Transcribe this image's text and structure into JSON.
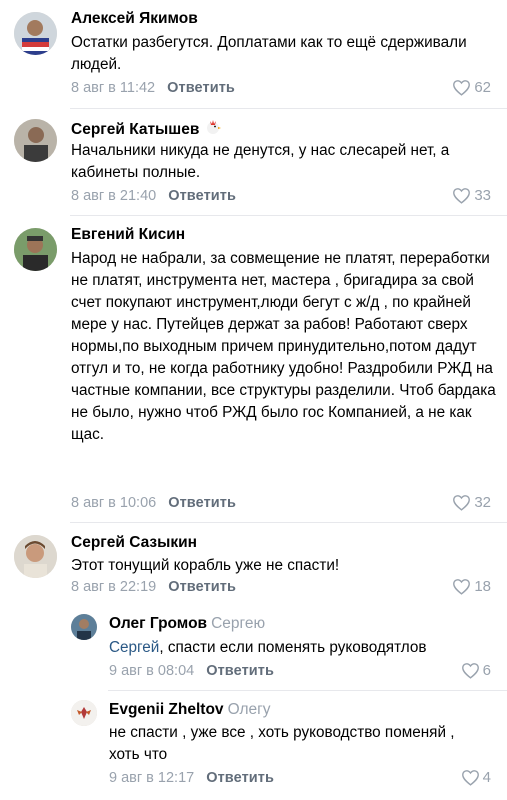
{
  "comments": [
    {
      "author": "Алексей Якимов",
      "text": "Остатки разбегутся. Доплатами как то ещё сдерживали людей.",
      "date": "8 авг в 11:42",
      "reply_label": "Ответить",
      "likes": "62"
    },
    {
      "author": "Сергей Катышев",
      "text": "Начальники никуда не денутся, у нас слесарей нет, а кабинеты полные.",
      "date": "8 авг в 21:40",
      "reply_label": "Ответить",
      "likes": "33"
    },
    {
      "author": "Евгений Кисин",
      "text": "Народ не набрали, за совмещение не платят, переработки не платят, инструмента нет, мастера , бригадира за свой счет покупают инструмент,люди бегут с ж/д , по крайней мере у нас. Путейцев держат за рабов! Работают сверх нормы,по выходным причем принудительно,потом дадут отгул и то, не когда работнику удобно! Раздробили РЖД на частные компании, все структуры разделили. Чтоб бардака не было, нужно чтоб РЖД было гос Компанией, а не как щас.",
      "date": "8 авг в 10:06",
      "reply_label": "Ответить",
      "likes": "32"
    },
    {
      "author": "Сергей Сазыкин",
      "text": "Этот тонущий корабль уже не спасти!",
      "date": "8 авг в 22:19",
      "reply_label": "Ответить",
      "likes": "18"
    }
  ],
  "replies": [
    {
      "author": "Олег Громов",
      "reply_to": "Сергею",
      "mention": "Сергей",
      "text": ", спасти если поменять руководятлов",
      "date": "9 авг в 08:04",
      "reply_label": "Ответить",
      "likes": "6"
    },
    {
      "author": "Evgenii Zheltov",
      "reply_to": "Олегу",
      "text": "не спасти , уже все , хоть руководство поменяй , хоть что",
      "date": "9 авг в 12:17",
      "reply_label": "Ответить",
      "likes": "4"
    }
  ],
  "colors": {
    "meta": "#99a2ad",
    "reply_button": "#626d7a",
    "mention": "#2a5885"
  },
  "icons": {
    "like": "heart-outline-icon"
  }
}
